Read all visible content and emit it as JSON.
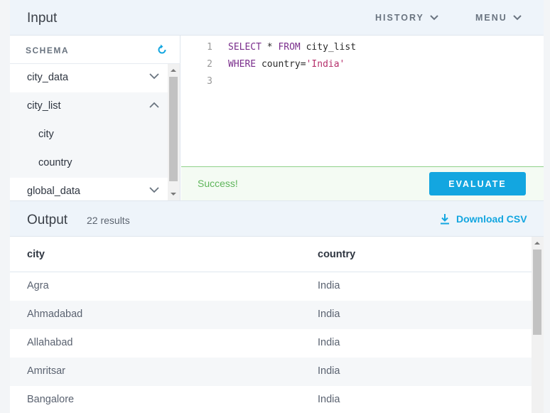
{
  "input": {
    "title": "Input",
    "history_label": "HISTORY",
    "menu_label": "MENU"
  },
  "schema": {
    "title": "SCHEMA",
    "items": [
      {
        "label": "city_data",
        "expanded": false,
        "level": 0
      },
      {
        "label": "city_list",
        "expanded": true,
        "level": 0
      },
      {
        "label": "city",
        "level": 1
      },
      {
        "label": "country",
        "level": 1
      },
      {
        "label": "global_data",
        "expanded": false,
        "level": 0
      }
    ]
  },
  "editor": {
    "lines": [
      {
        "num": "1",
        "kw1": "SELECT",
        "t1": " * ",
        "kw2": "FROM",
        "t2": " city_list",
        "str": ""
      },
      {
        "num": "2",
        "kw1": "WHERE",
        "t1": " country=",
        "kw2": "",
        "t2": "",
        "str": "'India'"
      },
      {
        "num": "3",
        "kw1": "",
        "t1": "",
        "kw2": "",
        "t2": "",
        "str": ""
      }
    ]
  },
  "status": {
    "text": "Success!",
    "evaluate_label": "EVALUATE"
  },
  "output": {
    "title": "Output",
    "count": "22 results",
    "download_label": "Download CSV",
    "columns": [
      "city",
      "country"
    ],
    "rows": [
      [
        "Agra",
        "India"
      ],
      [
        "Ahmadabad",
        "India"
      ],
      [
        "Allahabad",
        "India"
      ],
      [
        "Amritsar",
        "India"
      ],
      [
        "Bangalore",
        "India"
      ]
    ]
  },
  "colors": {
    "accent": "#13a6e0",
    "success": "#5eb55a",
    "keyword": "#7a2e8c",
    "string": "#b5306b"
  }
}
